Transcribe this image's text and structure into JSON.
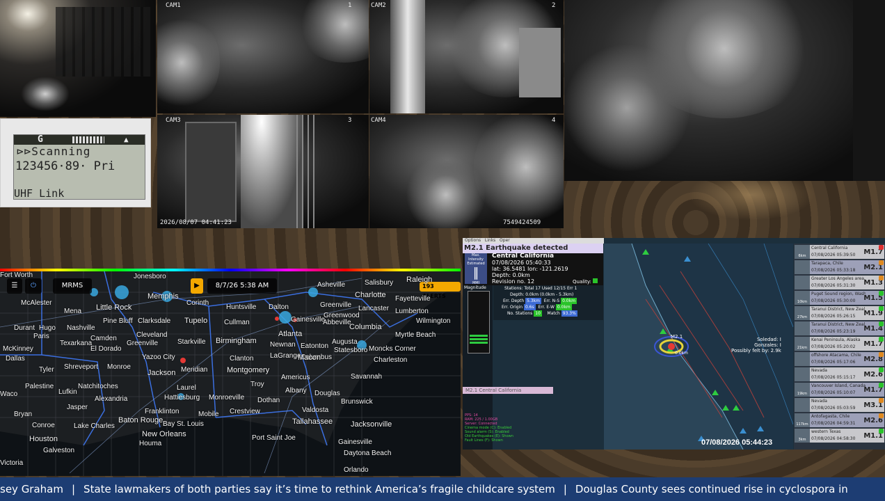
{
  "cameras": {
    "cam1_label": "CAM1",
    "cam2_label": "CAM2",
    "cam3_label": "CAM3",
    "cam4_label": "CAM4",
    "cam1_num": "1",
    "cam2_num": "2",
    "cam3_num": "3",
    "cam4_num": "4",
    "timestamp": "2026/08/07 04:41:23",
    "footer_id": "7549424509"
  },
  "scanner": {
    "group": "G",
    "line1": "⊳⊳Scanning",
    "line2": "123456·89·  Pri",
    "line3": "UHF Link"
  },
  "radar_map": {
    "timestamp": "8/7/26 5:38 AM",
    "alerts": "193 ALERTS",
    "menu_label": "MRMS",
    "cities": [
      "Jonesboro",
      "McAlester",
      "Little Rock",
      "Memphis",
      "Corinth",
      "Huntsville",
      "Asheville",
      "Salisbury",
      "Raleigh",
      "Dalton",
      "Greenville",
      "Charlotte",
      "Fayetteville",
      "Lancaster",
      "Lumberton",
      "Wilmington",
      "Greenwood",
      "Columbia",
      "Myrtle Beach",
      "Mena",
      "Nashville",
      "Pine Bluff",
      "Clarksdale",
      "Tupelo",
      "Cullman",
      "Gainesville",
      "Abbeville",
      "Durant",
      "Hugo",
      "Paris",
      "Texarkana",
      "Camden",
      "Cleveland",
      "Greenville",
      "Starkville",
      "Birmingham",
      "Atlanta",
      "Newnan",
      "Augusta",
      "Eatonton",
      "El Dorado",
      "Columbus",
      "Clanton",
      "LaGrange",
      "Macon",
      "Statesboro",
      "Charleston",
      "Moncks Corner",
      "McKinney",
      "Dallas",
      "Tyler",
      "Shreveport",
      "Monroe",
      "Yazoo City",
      "Jackson",
      "Meridian",
      "Montgomery",
      "Savannah",
      "Americus",
      "Troy",
      "Natchitoches",
      "Laurel",
      "Hattiesburg",
      "Albany",
      "Douglas",
      "Palestine",
      "Lufkin",
      "Alexandria",
      "Brunswick",
      "Bryan",
      "Jasper",
      "Dothan",
      "Crestview",
      "Valdosta",
      "Conroe",
      "Lake Charles",
      "Baton Rouge",
      "Monroeville",
      "Tallahassee",
      "Jacksonville",
      "Franklinton",
      "Bay St. Louis",
      "Mobile",
      "Houston",
      "Houma",
      "New Orleans",
      "Port Saint Joe",
      "Gainesville",
      "Galveston",
      "Victoria",
      "Daytona Beach",
      "Orlando",
      "Waco",
      "Fort Worth"
    ]
  },
  "quake": {
    "menu": [
      "Options",
      "Links",
      "Oper"
    ],
    "alert_title": "M2.1 Earthquake detected",
    "mmi_label": "Max. Intensity Estimated",
    "mmi_unit": "MMI",
    "region": "Central California",
    "datetime": "07/08/2026 05:40:33",
    "latlon": "lat: 36.5481 lon: -121.2619",
    "depth": "Depth: 0.0km",
    "revision": "Revision no. 12",
    "quality_label": "Quality:",
    "magnitude_label": "Magnitude",
    "stations_line": "Stations: Total 17 Used 12/15 Err 1",
    "depth_line": "Depth: 0.0km (0.0km - 5.3km)",
    "err_depth_label": "Err. Depth",
    "err_depth": "5.3km",
    "err_ns_label": "Err. N-S",
    "err_ns": "0.0km",
    "err_origin_label": "Err. Origin",
    "err_origin": "0.6s",
    "err_ew_label": "Err. E-W",
    "err_ew": "0.0km",
    "no_stations_label": "No. Stations",
    "no_stations": "10",
    "match_label": "Match",
    "match": "93.3%",
    "event_tag": "M2.1 Central California",
    "epicenter_label": "M2.1",
    "epicenter_depth": "0.0km",
    "side_info": [
      "Soledad: I",
      "Gonzales: I",
      "Possibly felt by: 2.9k"
    ],
    "map_time": "07/08/2026 05:44:23",
    "log": [
      "PPS: 14",
      "RAM: 225 / 1.00GB",
      "Server: Connected",
      "Cinema mode (C): Enabled",
      "Sound alarm (S): Enabled",
      "Old Earthquakes (E): Shown",
      "Fault Lines (F): Shown"
    ],
    "recent": [
      {
        "name": "Central California",
        "date": "07/08/2026 05:39:50",
        "mag": "M1.7",
        "dist": "6km",
        "color": "#e03030"
      },
      {
        "name": "Tarapaca, Chile",
        "date": "07/08/2026 05:33:18",
        "mag": "M2.1",
        "dist": "",
        "color": "#e08a20"
      },
      {
        "name": "Greater Los Angeles area, ...",
        "date": "07/08/2026 05:31:30",
        "mag": "M1.3",
        "dist": "",
        "color": "#e08a20"
      },
      {
        "name": "Puget Sound region, Washi...",
        "date": "07/08/2026 05:30:00",
        "mag": "M1.5",
        "dist": "10km",
        "color": "#2ac32a"
      },
      {
        "name": "Taranui District, New Zeal...",
        "date": "07/08/2026 05:26:15",
        "mag": "M1.9",
        "dist": "27km",
        "color": "#2ac32a"
      },
      {
        "name": "Taranui District, New Zeal...",
        "date": "07/08/2026 05:23:19",
        "mag": "M1.4",
        "dist": "",
        "color": "#2ac32a"
      },
      {
        "name": "Kenai Peninsula, Alaska",
        "date": "07/08/2026 05:20:02",
        "mag": "M1.7",
        "dist": "21km",
        "color": "#2ac32a"
      },
      {
        "name": "offshore Atacama, Chile",
        "date": "07/08/2026 05:17:06",
        "mag": "M2.8",
        "dist": "",
        "color": "#e08a20"
      },
      {
        "name": "Nevada",
        "date": "07/08/2026 05:15:17",
        "mag": "M2.6",
        "dist": "",
        "color": "#2ac32a"
      },
      {
        "name": "Vancouver Island, Canada r...",
        "date": "07/08/2026 05:10:07",
        "mag": "M1.7",
        "dist": "19km",
        "color": "#2ac32a"
      },
      {
        "name": "Nevada",
        "date": "07/08/2026 05:03:59",
        "mag": "M3.1",
        "dist": "",
        "color": "#e08a20"
      },
      {
        "name": "Antofagasta, Chile",
        "date": "07/08/2026 04:59:31",
        "mag": "M2.6",
        "dist": "117km",
        "color": "#e08a20"
      },
      {
        "name": "western Texas",
        "date": "07/08/2026 04:58:30",
        "mag": "M1.1",
        "dist": "3km",
        "color": "#2ac32a"
      }
    ]
  },
  "ticker": {
    "items": [
      "sey Graham",
      "State lawmakers of both parties say it’s time to rethink America’s fragile childcare system",
      "Douglas County sees continued rise in cyclospora in"
    ],
    "separator": "|"
  },
  "colors": {
    "ticker_bg": "#1d3d73",
    "alert_bg": "#dcd1f2",
    "alerts_badge": "#f3a800",
    "accent_blue": "#3c4d86"
  }
}
